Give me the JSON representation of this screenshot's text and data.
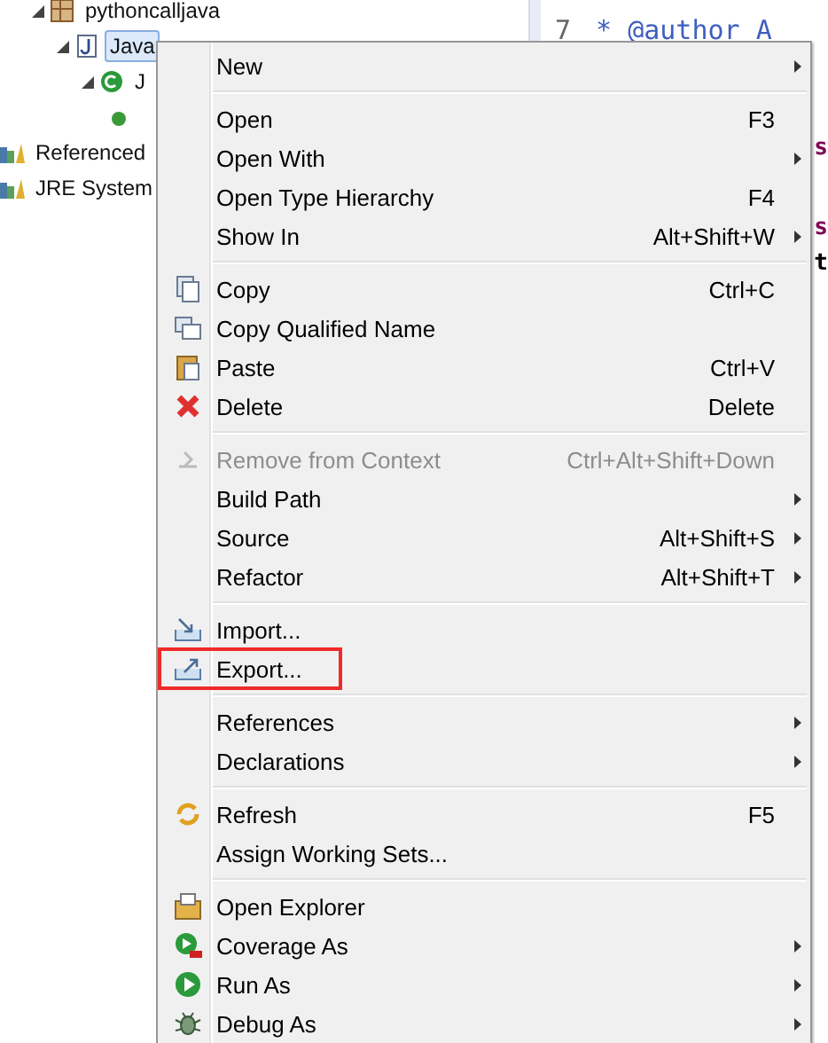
{
  "tree": [
    {
      "label": "pythoncalljava",
      "expanded": true,
      "selected": false,
      "children": [
        {
          "label": "Java",
          "expanded": true,
          "selected": true,
          "children": [
            {
              "label": "J",
              "expanded": true,
              "selected": false,
              "children": [
                {
                  "kind": "method"
                }
              ]
            }
          ]
        }
      ]
    },
    {
      "label": "Referenced",
      "selected": false
    },
    {
      "label": "JRE System",
      "selected": false
    }
  ],
  "editor": {
    "lines": [
      {
        "number": "7",
        "text": "* @author A"
      }
    ],
    "fragments": [
      "s",
      "s",
      "t"
    ]
  },
  "menu": [
    {
      "kind": "item",
      "label": "New",
      "submenu": true
    },
    {
      "kind": "separator"
    },
    {
      "kind": "item",
      "label": "Open",
      "shortcut": "F3"
    },
    {
      "kind": "item",
      "label": "Open With",
      "submenu": true
    },
    {
      "kind": "item",
      "label": "Open Type Hierarchy",
      "shortcut": "F4"
    },
    {
      "kind": "item",
      "label": "Show In",
      "shortcut": "Alt+Shift+W",
      "submenu": true
    },
    {
      "kind": "separator"
    },
    {
      "kind": "item",
      "label": "Copy",
      "shortcut": "Ctrl+C"
    },
    {
      "kind": "item",
      "label": "Copy Qualified Name"
    },
    {
      "kind": "item",
      "label": "Paste",
      "shortcut": "Ctrl+V"
    },
    {
      "kind": "item",
      "label": "Delete",
      "shortcut": "Delete"
    },
    {
      "kind": "separator"
    },
    {
      "kind": "item",
      "label": "Remove from Context",
      "shortcut": "Ctrl+Alt+Shift+Down",
      "disabled": true
    },
    {
      "kind": "item",
      "label": "Build Path",
      "submenu": true
    },
    {
      "kind": "item",
      "label": "Source",
      "shortcut": "Alt+Shift+S",
      "submenu": true
    },
    {
      "kind": "item",
      "label": "Refactor",
      "shortcut": "Alt+Shift+T",
      "submenu": true
    },
    {
      "kind": "separator"
    },
    {
      "kind": "item",
      "label": "Import..."
    },
    {
      "kind": "item",
      "label": "Export...",
      "highlighted": true
    },
    {
      "kind": "separator"
    },
    {
      "kind": "item",
      "label": "References",
      "submenu": true
    },
    {
      "kind": "item",
      "label": "Declarations",
      "submenu": true
    },
    {
      "kind": "separator"
    },
    {
      "kind": "item",
      "label": "Refresh",
      "shortcut": "F5"
    },
    {
      "kind": "item",
      "label": "Assign Working Sets..."
    },
    {
      "kind": "separator"
    },
    {
      "kind": "item",
      "label": "Open Explorer"
    },
    {
      "kind": "item",
      "label": "Coverage As",
      "submenu": true
    },
    {
      "kind": "item",
      "label": "Run As",
      "submenu": true
    },
    {
      "kind": "item",
      "label": "Debug As",
      "submenu": true
    }
  ]
}
